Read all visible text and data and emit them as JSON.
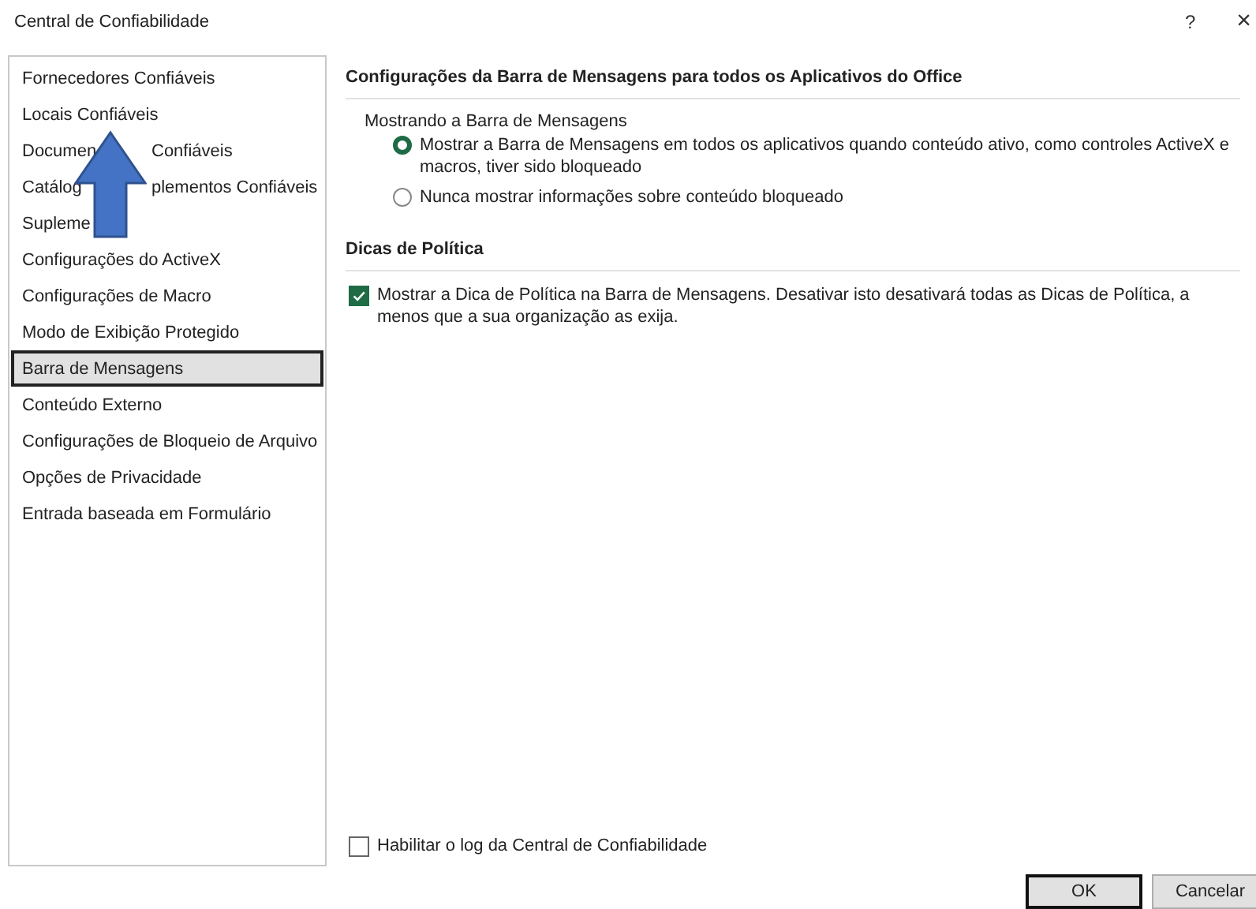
{
  "window": {
    "title": "Central de Confiabilidade",
    "help": "?",
    "close": "×"
  },
  "sidebar": {
    "items": [
      {
        "label": "Fornecedores Confiáveis",
        "selected": false
      },
      {
        "label": "Locais Confiáveis",
        "selected": false
      },
      {
        "label": "Documen",
        "label_after_arrow": "Confiáveis",
        "selected": false
      },
      {
        "label": "Catálog",
        "label_after_arrow": "plementos Confiáveis",
        "selected": false
      },
      {
        "label": "Supleme",
        "selected": false
      },
      {
        "label": "Configurações do ActiveX",
        "selected": false
      },
      {
        "label": "Configurações de Macro",
        "selected": false
      },
      {
        "label": "Modo de Exibição Protegido",
        "selected": false
      },
      {
        "label": "Barra de Mensagens",
        "selected": true
      },
      {
        "label": "Conteúdo Externo",
        "selected": false
      },
      {
        "label": "Configurações de Bloqueio de Arquivo",
        "selected": false
      },
      {
        "label": "Opções de Privacidade",
        "selected": false
      },
      {
        "label": "Entrada baseada em Formulário",
        "selected": false
      }
    ]
  },
  "sections": [
    {
      "heading": "Configurações da Barra de Mensagens para todos os Aplicativos do Office",
      "group_label": "Mostrando a Barra de Mensagens",
      "options": [
        {
          "kind": "radio",
          "label": "Mostrar a Barra de Mensagens em todos os aplicativos quando conteúdo ativo, como controles ActiveX e macros, tiver sido bloqueado",
          "selected": true
        },
        {
          "kind": "radio",
          "label": "Nunca mostrar informações sobre conteúdo bloqueado",
          "selected": false
        }
      ]
    },
    {
      "heading": "Dicas de Política",
      "options": [
        {
          "kind": "checkbox",
          "label": "Mostrar a Dica de Política na Barra de Mensagens. Desativar isto desativará todas as Dicas de Política, a menos que a sua organização as exija.",
          "checked": true
        }
      ]
    }
  ],
  "log_option": {
    "label": "Habilitar o log da Central de Confiabilidade",
    "checked": false
  },
  "buttons": [
    {
      "label": "OK",
      "default": true
    },
    {
      "label": "Cancelar",
      "default": false
    }
  ]
}
